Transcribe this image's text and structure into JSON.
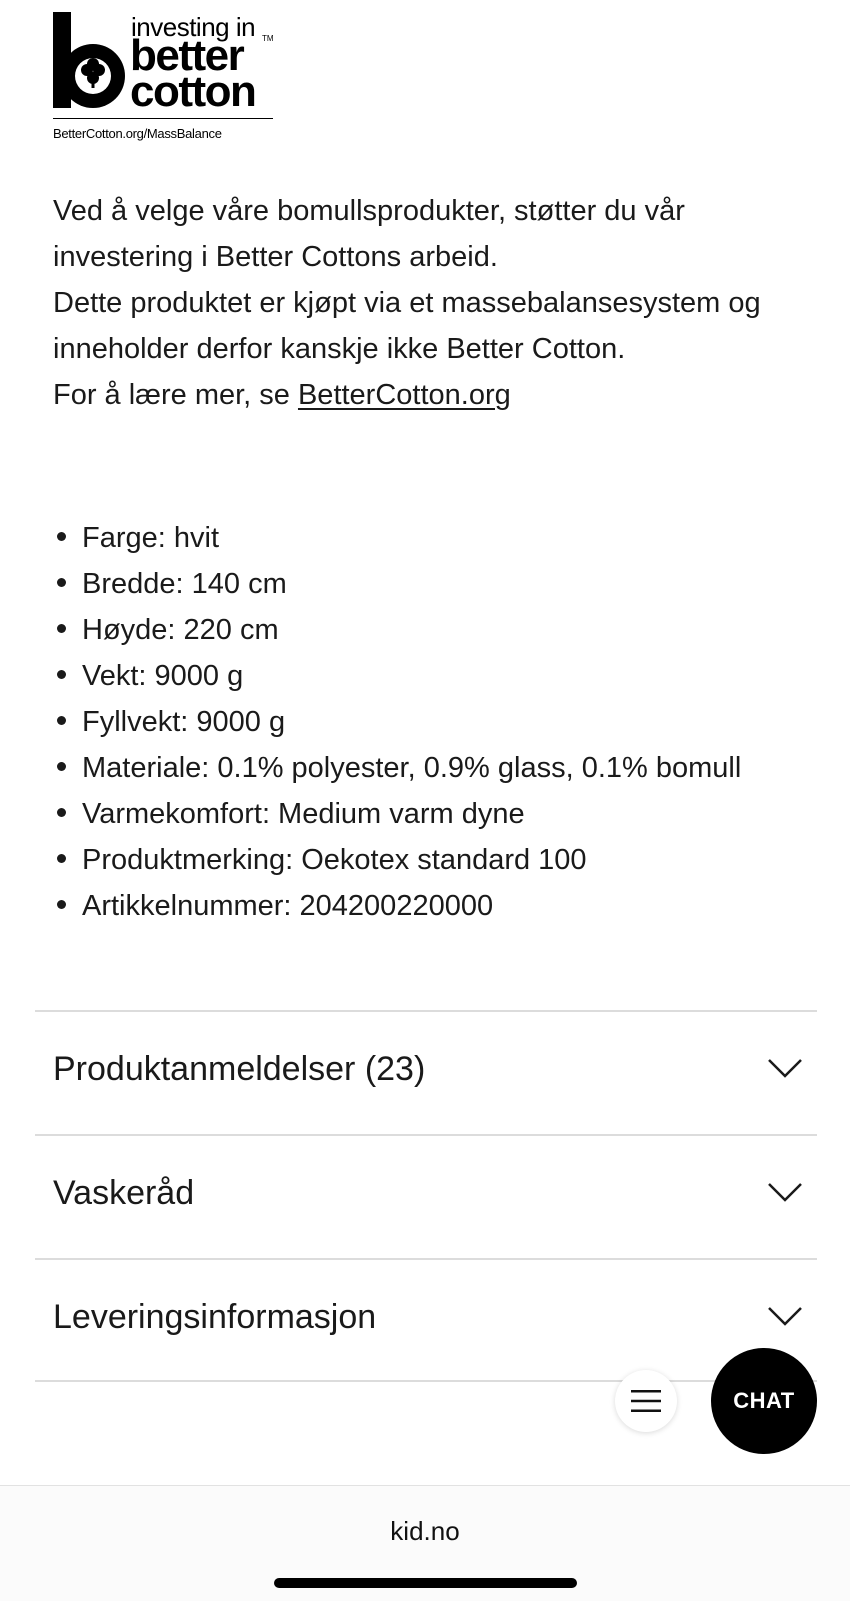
{
  "logo": {
    "line1": "investing in",
    "line2": "better",
    "line3": "cotton",
    "tm": "TM",
    "url": "BetterCotton.org/MassBalance"
  },
  "description": {
    "para1": "Ved å velge våre bomullsprodukter, støtter du vår investering i Better Cottons arbeid.",
    "para2": "Dette produktet er kjøpt via et massebalansesystem og inneholder derfor kanskje ikke Better Cotton.",
    "para3_prefix": "For å lære mer, se ",
    "link_text": "BetterCotton.org"
  },
  "specs": [
    "Farge: hvit",
    "Bredde: 140 cm",
    "Høyde: 220 cm",
    "Vekt: 9000 g",
    "Fyllvekt: 9000 g",
    "Materiale: 0.1% polyester, 0.9% glass, 0.1% bomull",
    "Varmekomfort: Medium varm dyne",
    "Produktmerking: Oekotex standard 100",
    "Artikkelnummer: 204200220000"
  ],
  "accordion": {
    "reviews": "Produktanmeldelser (23)",
    "washing": "Vaskeråd",
    "delivery": "Leveringsinformasjon"
  },
  "fab": {
    "chat_label": "CHAT"
  },
  "browser": {
    "url": "kid.no"
  }
}
